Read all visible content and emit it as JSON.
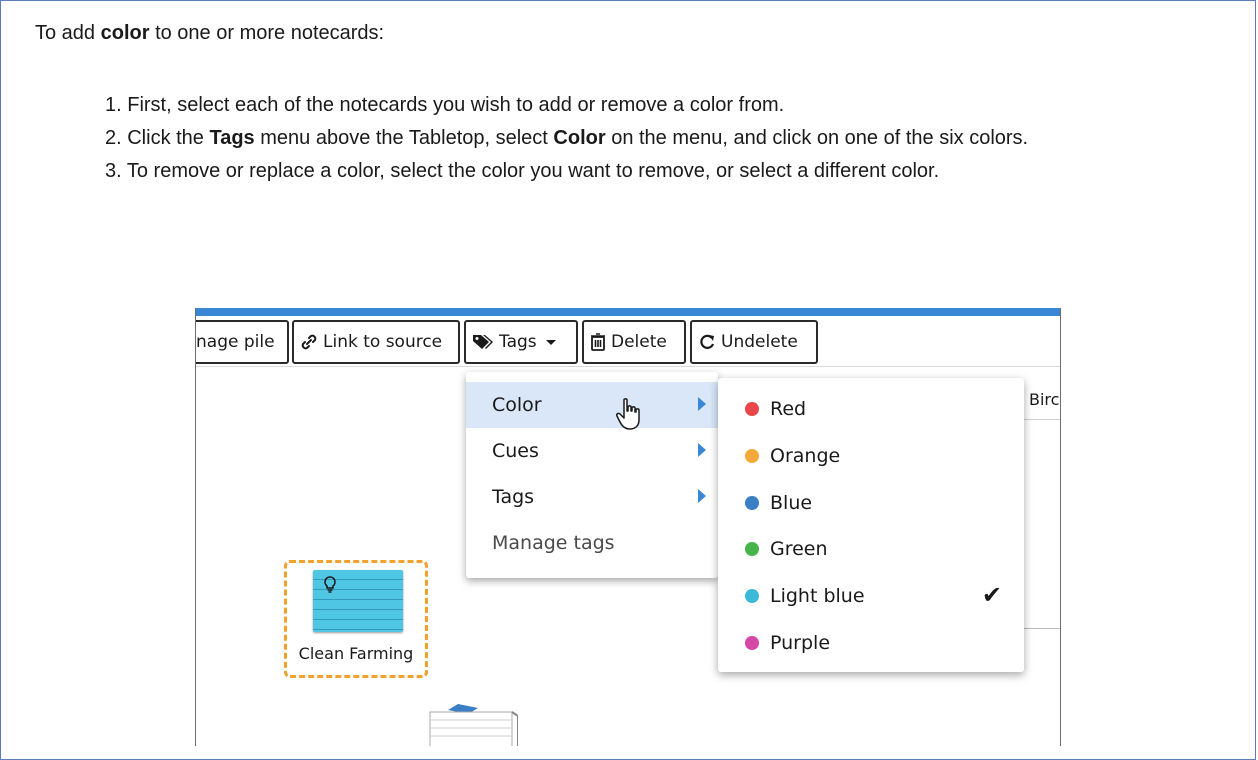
{
  "intro": {
    "pre": "To add ",
    "bold": "color",
    "post": " to one or more notecards:"
  },
  "steps": [
    {
      "pre": "1. First, select each of the notecards you wish to add or remove a color from."
    },
    {
      "pre": "2. Click the ",
      "b1": "Tags",
      "mid": " menu above the Tabletop, select ",
      "b2": "Color",
      "post": " on the menu, and click on one of the six colors."
    },
    {
      "pre": "3. To remove or replace a color, select the color you want to remove, or select a different color."
    }
  ],
  "toolbar": {
    "manage_pile": "nage pile",
    "link_to_source": "Link to source",
    "tags": "Tags",
    "delete": "Delete",
    "undelete": "Undelete"
  },
  "tab_partial": "Birc",
  "menu": {
    "items": [
      {
        "label": "Color",
        "has_submenu": true,
        "active": true
      },
      {
        "label": "Cues",
        "has_submenu": true
      },
      {
        "label": "Tags",
        "has_submenu": true
      },
      {
        "label": "Manage tags",
        "has_submenu": false
      }
    ]
  },
  "color_submenu": {
    "items": [
      {
        "label": "Red",
        "color": "#e8464a",
        "checked": false
      },
      {
        "label": "Orange",
        "color": "#f4a93b",
        "checked": false
      },
      {
        "label": "Blue",
        "color": "#3a7ec6",
        "checked": false
      },
      {
        "label": "Green",
        "color": "#48b54c",
        "checked": false
      },
      {
        "label": "Light blue",
        "color": "#3cb8d8",
        "checked": true
      },
      {
        "label": "Purple",
        "color": "#d447a6",
        "checked": false
      }
    ],
    "check_glyph": "✔"
  },
  "notecard": {
    "label": "Clean Farming",
    "color": "#4fc6e3"
  },
  "colors": {
    "accent": "#3a87d6",
    "selection": "#f2a12c",
    "frame": "#5b7fb5"
  }
}
